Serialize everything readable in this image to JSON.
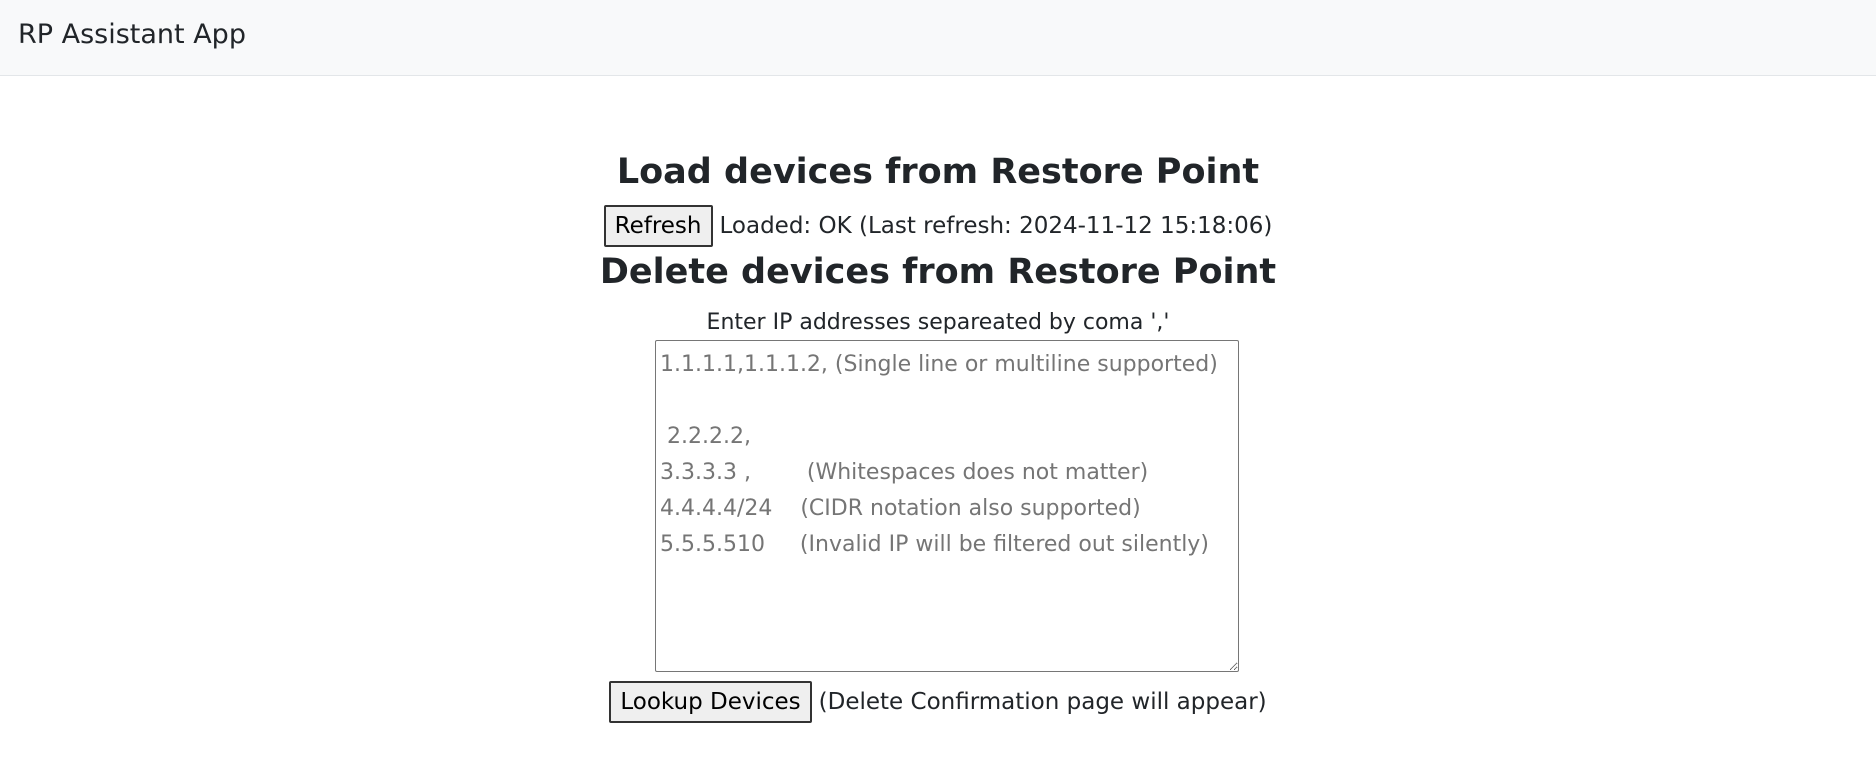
{
  "navbar": {
    "brand": "RP Assistant App"
  },
  "load_section": {
    "title": "Load devices from Restore Point",
    "refresh_label": "Refresh",
    "status_text": "Loaded: OK (Last refresh: 2024-11-12 15:18:06)"
  },
  "delete_section": {
    "title": "Delete devices from Restore Point",
    "prompt": "Enter IP addresses separeated by coma ','",
    "ip_input": {
      "value": "",
      "placeholder": "1.1.1.1,1.1.1.2, (Single line or multiline supported)\n\n 2.2.2.2,\n3.3.3.3 ,        (Whitespaces does not matter)\n4.4.4.4/24    (CIDR notation also supported)\n5.5.5.510     (Invalid IP will be filtered out silently)"
    },
    "lookup_label": "Lookup Devices",
    "lookup_note": "(Delete Confirmation page will appear)"
  }
}
